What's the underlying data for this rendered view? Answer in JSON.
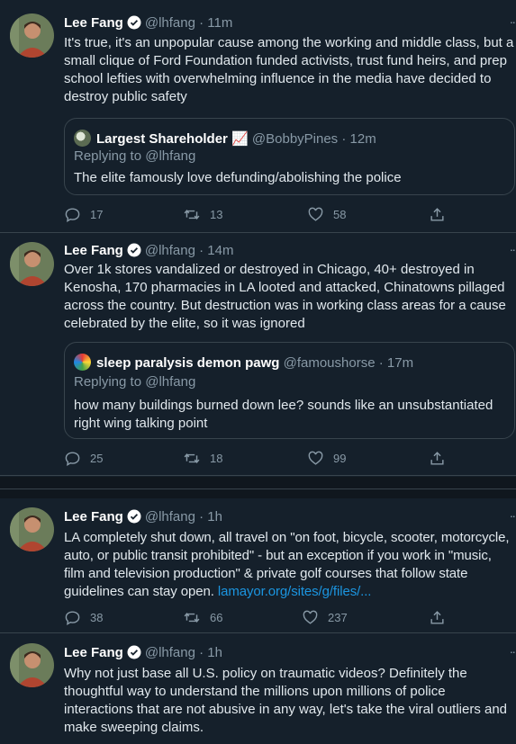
{
  "tweets": [
    {
      "name": "Lee Fang",
      "handle": "@lhfang",
      "time": "· 11m",
      "text": "It's true, it's an unpopular cause among the working and middle class, but a small clique of Ford Foundation funded activists, trust fund heirs, and prep school lefties with overwhelming influence in the media have decided to destroy public safety",
      "quote": {
        "name": "Largest Shareholder 📈",
        "handle": "@BobbyPines",
        "time": "· 12m",
        "replying_label": "Replying to",
        "replying_handle": "@lhfang",
        "text": "The elite famously love defunding/abolishing the police"
      },
      "replies": "17",
      "retweets": "13",
      "likes": "58"
    },
    {
      "name": "Lee Fang",
      "handle": "@lhfang",
      "time": "· 14m",
      "text": "Over 1k stores vandalized or destroyed in Chicago, 40+ destroyed in Kenosha, 170 pharmacies in LA looted and attacked, Chinatowns pillaged across the country. But destruction was in working class areas for a cause celebrated by the elite, so it was ignored",
      "quote": {
        "name": "sleep paralysis demon pawg",
        "handle": "@famoushorse",
        "time": "· 17m",
        "replying_label": "Replying to",
        "replying_handle": "@lhfang",
        "text": "how many buildings burned down lee? sounds like an unsubstantiated right wing talking point"
      },
      "replies": "25",
      "retweets": "18",
      "likes": "99"
    },
    {
      "name": "Lee Fang",
      "handle": "@lhfang",
      "time": "· 1h",
      "text": "LA completely shut down, all travel on \"on foot, bicycle, scooter, motorcycle, auto, or public transit prohibited\" - but an exception if you work in \"music, film and television production\" & private golf courses that follow state guidelines can stay open.",
      "link": "lamayor.org/sites/g/files/...",
      "replies": "38",
      "retweets": "66",
      "likes": "237"
    },
    {
      "name": "Lee Fang",
      "handle": "@lhfang",
      "time": "· 1h",
      "text": "Why not just base all U.S. policy on traumatic videos? Definitely the thoughtful way to understand the millions upon millions of police interactions that are not abusive in any way, let's take the viral outliers and make sweeping claims."
    }
  ],
  "more_icon": "··",
  "colors": {
    "background": "#15202b",
    "border": "#38444d",
    "muted": "#8899a6",
    "link": "#1b95e0",
    "verified": "#ffffff"
  }
}
